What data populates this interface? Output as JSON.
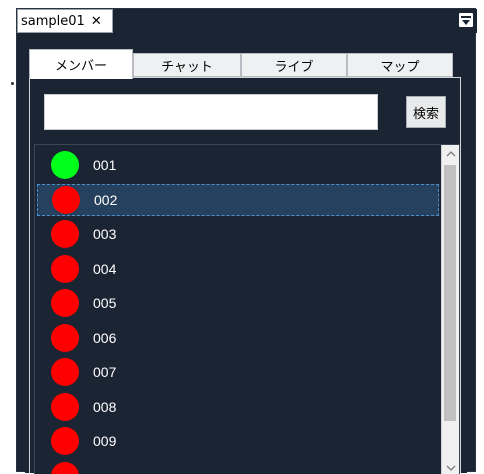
{
  "window": {
    "tab_title": "sample01",
    "close_glyph": "✕"
  },
  "tabs": [
    {
      "label": "メンバー",
      "active": true
    },
    {
      "label": "チャット",
      "active": false
    },
    {
      "label": "ライブ",
      "active": false
    },
    {
      "label": "マップ",
      "active": false
    }
  ],
  "search": {
    "value": "",
    "placeholder": "",
    "button_label": "検索"
  },
  "members": {
    "selected_index": 1,
    "items": [
      {
        "label": "001",
        "status_color": "#00ff1a"
      },
      {
        "label": "002",
        "status_color": "#ff0000"
      },
      {
        "label": "003",
        "status_color": "#ff0000"
      },
      {
        "label": "004",
        "status_color": "#ff0000"
      },
      {
        "label": "005",
        "status_color": "#ff0000"
      },
      {
        "label": "006",
        "status_color": "#ff0000"
      },
      {
        "label": "007",
        "status_color": "#ff0000"
      },
      {
        "label": "008",
        "status_color": "#ff0000"
      },
      {
        "label": "009",
        "status_color": "#ff0000"
      },
      {
        "label": "",
        "status_color": "#ff0000"
      }
    ]
  },
  "colors": {
    "panel_background": "#1b2433",
    "selection_background": "#26415e",
    "selection_border": "#4e8fc9"
  }
}
